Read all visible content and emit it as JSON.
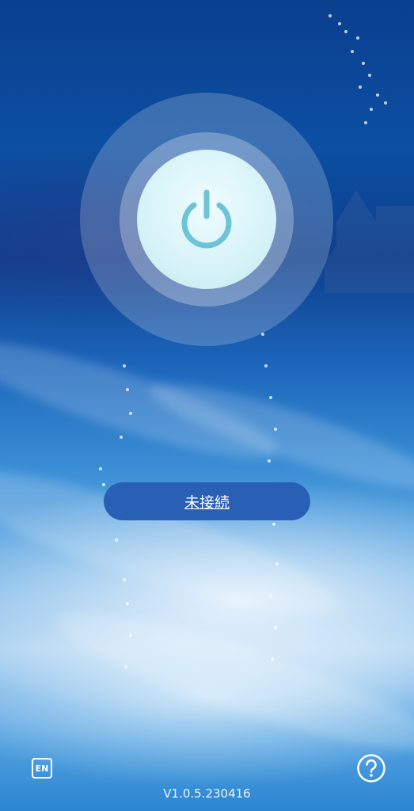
{
  "status": {
    "label": "未接続"
  },
  "language_button": {
    "label": "EN"
  },
  "help_button": {
    "icon": "question-icon"
  },
  "power_button": {
    "icon": "power-icon",
    "icon_color": "#6cc4d6"
  },
  "footer": {
    "version": "V1.0.5.230416"
  },
  "colors": {
    "status_pill": "#2a5fb6",
    "text": "#ffffff"
  }
}
